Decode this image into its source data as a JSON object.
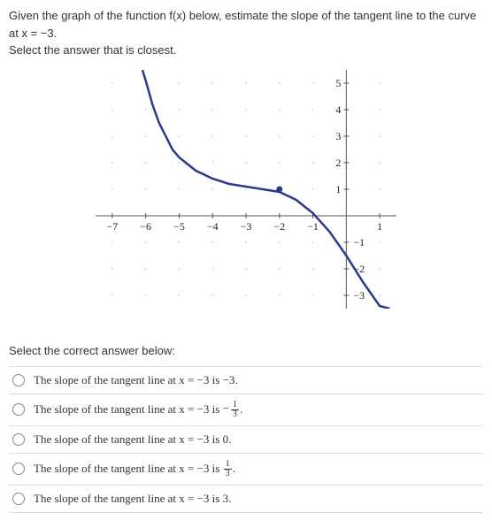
{
  "question": {
    "line1": "Given the graph of the function f(x) below, estimate the slope of the tangent line to the curve at x = −3.",
    "line2": "Select the answer that is closest."
  },
  "prompt": "Select the correct answer below:",
  "options": [
    {
      "prefix": "The slope of the tangent line at x = −3 is ",
      "value": "−3",
      "suffix": ".",
      "frac": null
    },
    {
      "prefix": "The slope of the tangent line at x = −3 is ",
      "value": "",
      "suffix": ".",
      "frac": {
        "neg": true,
        "num": "1",
        "den": "3"
      }
    },
    {
      "prefix": "The slope of the tangent line at x = −3 is ",
      "value": "0",
      "suffix": ".",
      "frac": null
    },
    {
      "prefix": "The slope of the tangent line at x = −3 is ",
      "value": "",
      "suffix": ".",
      "frac": {
        "neg": false,
        "num": "1",
        "den": "3"
      }
    },
    {
      "prefix": "The slope of the tangent line at x = −3 is ",
      "value": "3",
      "suffix": ".",
      "frac": null
    }
  ],
  "chart_data": {
    "type": "line",
    "title": "",
    "xlabel": "",
    "ylabel": "",
    "xlim": [
      -7.5,
      1.5
    ],
    "ylim": [
      -3.5,
      5.5
    ],
    "x_ticks": [
      -7,
      -6,
      -5,
      -4,
      -3,
      -2,
      -1,
      1
    ],
    "y_ticks": [
      -3,
      -2,
      -1,
      1,
      2,
      3,
      4,
      5
    ],
    "grid": "dotted",
    "series": [
      {
        "name": "f(x)",
        "color": "#2a3a8f",
        "x": [
          -6.1,
          -6.0,
          -5.8,
          -5.6,
          -5.4,
          -5.2,
          -5.0,
          -4.5,
          -4.0,
          -3.5,
          -3.0,
          -2.5,
          -2.0,
          -1.5,
          -1.0,
          -0.5,
          0.0,
          0.5,
          1.0,
          1.3
        ],
        "y": [
          5.5,
          5.1,
          4.2,
          3.5,
          3.0,
          2.5,
          2.2,
          1.7,
          1.4,
          1.2,
          1.1,
          1.0,
          0.9,
          0.6,
          0.1,
          -0.6,
          -1.5,
          -2.5,
          -3.4,
          -3.5
        ]
      }
    ],
    "highlight_point": {
      "x": -2,
      "y": 1
    }
  }
}
